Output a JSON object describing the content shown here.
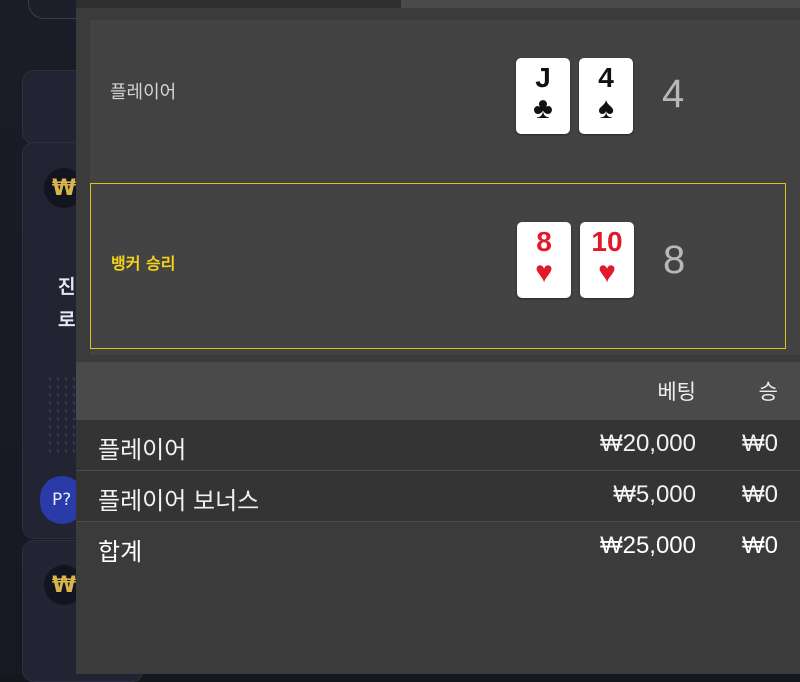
{
  "background": {
    "won_symbol": "₩",
    "side_text_1": "진",
    "side_text_2": "로",
    "pill_label": "P?"
  },
  "result": {
    "player": {
      "label": "플레이어",
      "cards": [
        {
          "rank": "J",
          "suit": "♣",
          "color": "#111111"
        },
        {
          "rank": "4",
          "suit": "♠",
          "color": "#111111"
        }
      ],
      "score": "4"
    },
    "banker": {
      "label": "뱅커 승리",
      "cards": [
        {
          "rank": "8",
          "suit": "♥",
          "color": "#e0192b"
        },
        {
          "rank": "10",
          "suit": "♥",
          "color": "#e0192b"
        }
      ],
      "score": "8"
    },
    "highlight_color": "#e0c21f"
  },
  "table": {
    "headers": {
      "bet": "베팅",
      "win": "승"
    },
    "rows": [
      {
        "name": "플레이어",
        "bet": "₩20,000",
        "win": "₩0"
      },
      {
        "name": "플레이어 보너스",
        "bet": "₩5,000",
        "win": "₩0"
      }
    ],
    "total": {
      "name": "합계",
      "bet": "₩25,000",
      "win": "₩0"
    }
  }
}
